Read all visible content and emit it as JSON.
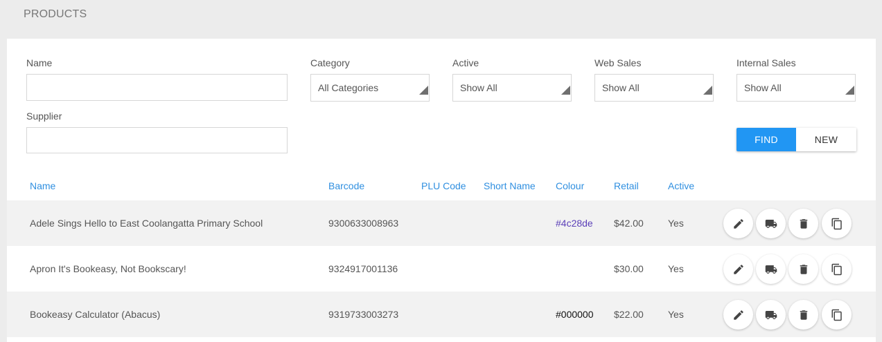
{
  "page": {
    "title": "PRODUCTS"
  },
  "filters": {
    "name": {
      "label": "Name",
      "value": "",
      "placeholder": ""
    },
    "category": {
      "label": "Category",
      "value": "All Categories"
    },
    "active": {
      "label": "Active",
      "value": "Show All"
    },
    "web_sales": {
      "label": "Web Sales",
      "value": "Show All"
    },
    "internal_sales": {
      "label": "Internal Sales",
      "value": "Show All"
    },
    "supplier": {
      "label": "Supplier",
      "value": "",
      "placeholder": ""
    }
  },
  "actions": {
    "find_label": "FIND",
    "new_label": "NEW"
  },
  "table": {
    "columns": [
      "Name",
      "Barcode",
      "PLU Code",
      "Short Name",
      "Colour",
      "Retail",
      "Active"
    ],
    "rows": [
      {
        "name": "Adele Sings Hello to East Coolangatta Primary School",
        "barcode": "9300633008963",
        "plu_code": "",
        "short_name": "",
        "colour": "#4c28de",
        "retail": "$42.00",
        "active": "Yes"
      },
      {
        "name": "Apron It's Bookeasy, Not Bookscary!",
        "barcode": "9324917001136",
        "plu_code": "",
        "short_name": "",
        "colour": "",
        "retail": "$30.00",
        "active": "Yes"
      },
      {
        "name": "Bookeasy Calculator (Abacus)",
        "barcode": "9319733003273",
        "plu_code": "",
        "short_name": "",
        "colour": "#000000",
        "retail": "$22.00",
        "active": "Yes"
      }
    ]
  },
  "row_actions": [
    "edit-icon",
    "truck-icon",
    "trash-icon",
    "copy-icon"
  ],
  "colors": {
    "accent": "#2196f3",
    "header_text": "#2f8fe0",
    "row_shade": "#f2f2f2",
    "colour_link": "#5b3fb8"
  }
}
